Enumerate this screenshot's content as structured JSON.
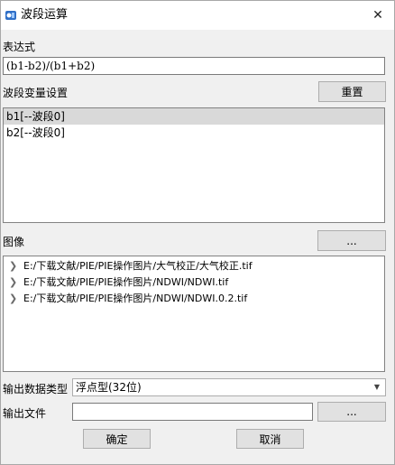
{
  "window": {
    "title": "波段运算",
    "close_glyph": "✕"
  },
  "expression": {
    "label": "表达式",
    "value": "(b1-b2)/(b1+b2)"
  },
  "band_settings": {
    "label": "波段变量设置",
    "reset_label": "重置",
    "items": [
      {
        "text": "b1[--波段0]",
        "selected": true
      },
      {
        "text": "b2[--波段0]",
        "selected": false
      }
    ]
  },
  "images": {
    "label": "图像",
    "browse_label": "...",
    "items": [
      "E:/下载文献/PIE/PIE操作图片/大气校正/大气校正.tif",
      "E:/下载文献/PIE/PIE操作图片/NDWI/NDWI.tif",
      "E:/下载文献/PIE/PIE操作图片/NDWI/NDWI.0.2.tif"
    ]
  },
  "output_type": {
    "label": "输出数据类型",
    "selected": "浮点型(32位)"
  },
  "output_file": {
    "label": "输出文件",
    "value": "",
    "browse_label": "..."
  },
  "actions": {
    "ok_label": "确定",
    "cancel_label": "取消"
  },
  "colors": {
    "selection": "#d9d9d9",
    "button_face": "#e1e1e1",
    "dialog_bg": "#f0f0f0"
  }
}
